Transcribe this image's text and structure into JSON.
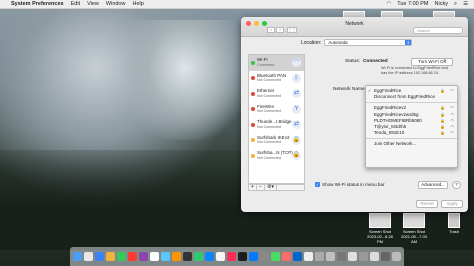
{
  "menubar": {
    "app_name": "System Preferences",
    "items": [
      "Edit",
      "View",
      "Window",
      "Help"
    ],
    "clock": "Tue 7:00 PM",
    "user": "Nicky"
  },
  "desktop": {
    "icons": [
      {
        "label": "Screen Shot 2023-02...6.28 PM"
      },
      {
        "label": "Screen Shot 2021-05...7.03 AM"
      },
      {
        "label": "Trash"
      }
    ]
  },
  "window": {
    "title": "Network",
    "search_placeholder": "Search",
    "location_label": "Location:",
    "location_value": "Automatic",
    "services": [
      {
        "name": "Wi-Fi",
        "status": "Connected",
        "color": "#3fbf4a",
        "icon": "wifi-icon",
        "glyph": "◠",
        "selected": true
      },
      {
        "name": "Bluetooth PAN",
        "status": "Not Connected",
        "color": "#e0443a",
        "icon": "bluetooth-icon",
        "glyph": "ᛒ"
      },
      {
        "name": "Ethernet",
        "status": "Not Connected",
        "color": "#e0443a",
        "icon": "ethernet-icon",
        "glyph": "⇄"
      },
      {
        "name": "FireWire",
        "status": "Not Connected",
        "color": "#e0443a",
        "icon": "firewire-icon",
        "glyph": "Y"
      },
      {
        "name": "Thunde...t Bridge",
        "status": "Not Connected",
        "color": "#e0443a",
        "icon": "thunderbolt-icon",
        "glyph": "⇄"
      },
      {
        "name": "Surfshark IKEv2",
        "status": "Not Connected",
        "color": "#f0b43a",
        "icon": "vpn-icon",
        "glyph": "🔒"
      },
      {
        "name": "Surfsha...N (TCP)",
        "status": "Not Connected",
        "color": "#f0b43a",
        "icon": "vpn-icon",
        "glyph": "🔒"
      }
    ],
    "list_controls": [
      "+",
      "−",
      "⚙▾"
    ],
    "status_label": "Status:",
    "status_value": "Connected",
    "turn_off_button": "Turn Wi-Fi Off",
    "status_description": "Wi-Fi is connected to EggFriedRice and has the IP address 192.168.86.24.",
    "network_name_label": "Network Name",
    "network_menu": {
      "current": "EggFriedRice",
      "disconnect": "Disconnect from EggFriedRice",
      "networks": [
        "EggFriedRicev2",
        "EggFriedRicev2and5g",
        "PLDTHOMEFIBRb5080",
        "T@ylor_M3d!h5",
        "Tenda_091E10"
      ],
      "join_other": "Join Other Network..."
    },
    "show_wifi_label": "Show Wi-Fi status in menu bar",
    "advanced_button": "Advanced...",
    "help_button": "?",
    "revert_button": "Revert",
    "apply_button": "Apply"
  },
  "dock": {
    "colors": [
      "#4a9ff5",
      "#e8e8e8",
      "#3b82f6",
      "#f0b43a",
      "#34c759",
      "#ff3b30",
      "#8e44ad",
      "#ffffff",
      "#5ac8fa",
      "#ff9500",
      "#333333",
      "#2ecc71",
      "#0a84ff",
      "#f5f5f5",
      "#ff2d55",
      "#1c1c1e",
      "#007aff",
      "#888888",
      "#4cd964",
      "#ff6b6b",
      "#0066cc",
      "#eeeeee",
      "#aaaaaa",
      "#c0c0c0",
      "#777777",
      "#e0e0e0",
      "#999999",
      "#dddddd",
      "#666666",
      "#bbbbbb"
    ]
  }
}
